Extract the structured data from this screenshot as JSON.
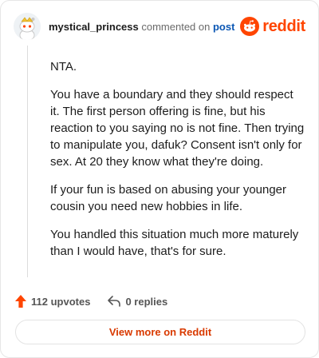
{
  "header": {
    "username": "mystical_princess",
    "action": "commented on",
    "post_link": "post",
    "brand": "reddit"
  },
  "comment": {
    "paragraphs": [
      "NTA.",
      "You have a boundary and they should respect it. The first person offering is fine, but his reaction to you saying no is not fine. Then trying to manipulate you, dafuk? Consent isn't only for sex. At 20 they know what they're doing.",
      "If your fun is based on abusing your younger cousin you need new hobbies in life.",
      "You handled this situation much more maturely than I would have, that's for sure."
    ]
  },
  "footer": {
    "upvotes": "112 upvotes",
    "replies": "0 replies"
  },
  "cta": {
    "label": "View more on Reddit"
  },
  "icons": {
    "avatar": "snoo-avatar-icon",
    "brand": "reddit-logo-icon",
    "upvote": "upvote-arrow-icon",
    "reply": "reply-arrow-icon"
  },
  "colors": {
    "brand": "#ff4500",
    "link": "#0b57b4",
    "cta": "#d93a00"
  }
}
